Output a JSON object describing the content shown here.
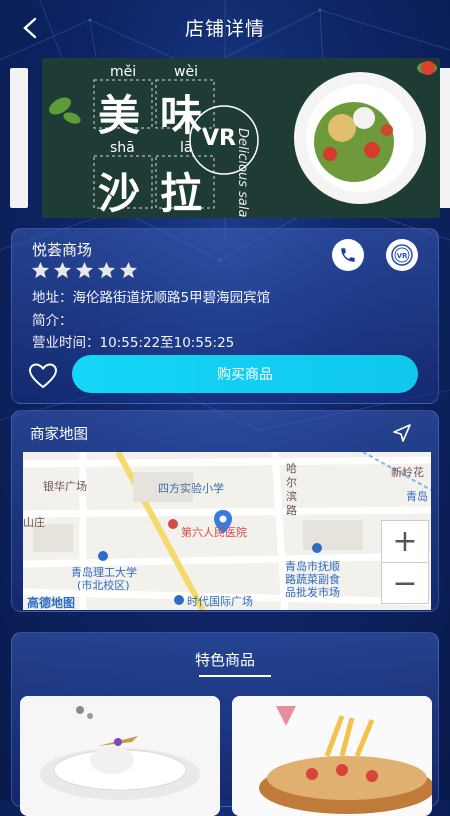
{
  "header": {
    "title": "店铺详情",
    "back_icon": "chevron-left-icon"
  },
  "banner": {
    "pinyin": [
      "měi",
      "wèi",
      "shā",
      "lā"
    ],
    "chars": [
      "美",
      "味",
      "沙",
      "拉"
    ],
    "vr_badge": "VR",
    "script_text": "Delicious salad",
    "bg_color": "#1f3b35"
  },
  "store": {
    "name": "悦荟商场",
    "rating": 5,
    "address_label": "地址：海伦路街道抚顺路5甲碧海园宾馆",
    "intro_label": "简介：",
    "hours_label": "营业时间：10:55:22至10:55:25",
    "buy_button": "购买商品",
    "vr_icon_text": "VR",
    "accent": "#14d6f6"
  },
  "map_section": {
    "title": "商家地图",
    "labels": {
      "yinhua": "银华广场",
      "sifang": "四方实验小学",
      "harbin1": "哈",
      "harbin2": "尔",
      "harbin3": "滨",
      "harbin4": "路",
      "hospital": "第六人民医院",
      "shanzhuang": "山庄",
      "qdlg1": "青岛理工大学",
      "qdlg2": "(市北校区)",
      "gaode": "高德地图",
      "shidai": "时代国际广场",
      "market1": "青岛市抚顺",
      "market2": "路蔬菜副食",
      "market3": "品批发市场",
      "xinling": "新岭花",
      "qingdao": "青岛"
    },
    "zoom_in": "+",
    "zoom_out": "−"
  },
  "featured": {
    "title": "特色商品"
  }
}
